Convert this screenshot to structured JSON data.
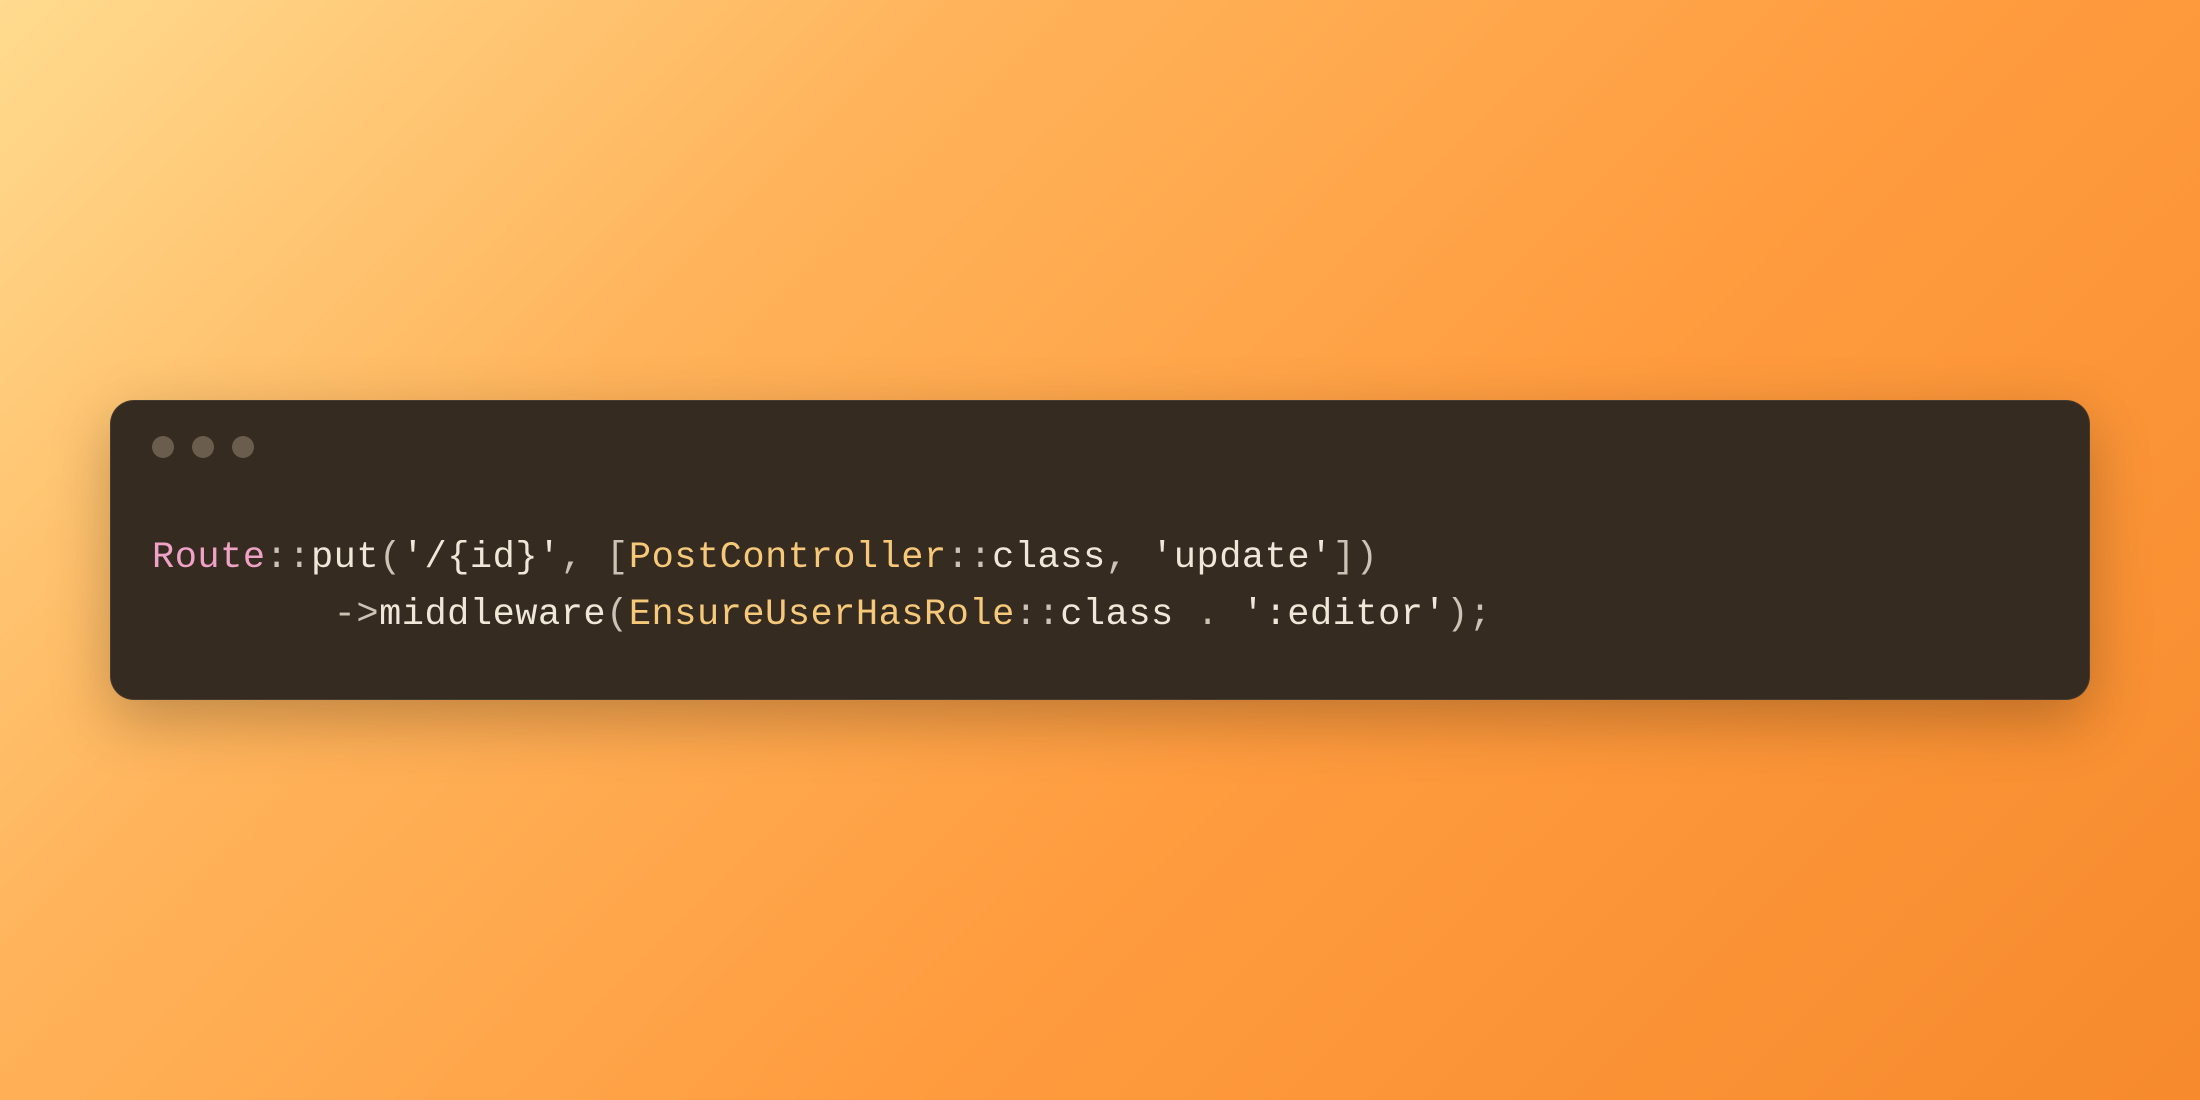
{
  "code": {
    "line1": {
      "t1": "Route",
      "t2": "::",
      "t3": "put",
      "t4": "(",
      "t5": "'/{id}'",
      "t6": ", [",
      "t7": "PostController",
      "t8": "::",
      "t9": "class",
      "t10": ", ",
      "t11": "'update'",
      "t12": "])"
    },
    "line2": {
      "indent": "        ",
      "t1": "->",
      "t2": "middleware",
      "t3": "(",
      "t4": "EnsureUserHasRole",
      "t5": "::",
      "t6": "class",
      "t7": " . ",
      "t8": "':editor'",
      "t9": ");"
    }
  }
}
